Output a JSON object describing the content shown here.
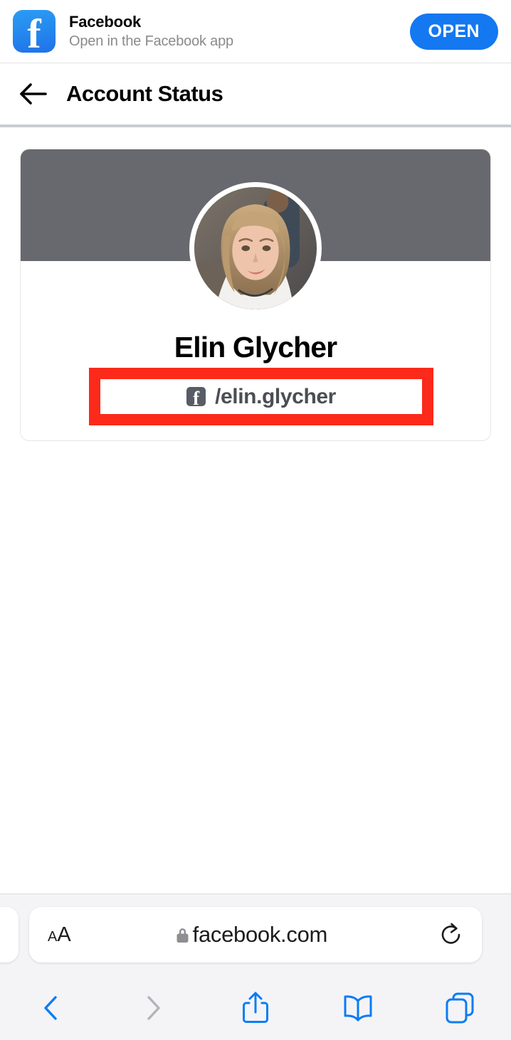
{
  "app_banner": {
    "app_name": "Facebook",
    "subtitle": "Open in the Facebook app",
    "open_label": "OPEN",
    "icon_glyph": "f",
    "icon_name": "facebook-app-icon",
    "accent_color": "#1478f0"
  },
  "nav": {
    "title": "Account Status",
    "back_icon": "back-arrow-icon"
  },
  "profile": {
    "cover_color": "#68696e",
    "display_name": "Elin Glycher",
    "handle": "/elin.glycher",
    "handle_badge_glyph": "f",
    "highlight_color": "#fb2a1b"
  },
  "browser": {
    "aa_small": "A",
    "aa_large": "A",
    "url": "facebook.com",
    "lock_icon": "lock-icon",
    "reload_icon": "reload-icon",
    "toolbar": [
      {
        "name": "back-icon",
        "label": "Back",
        "enabled": true
      },
      {
        "name": "forward-icon",
        "label": "Forward",
        "enabled": false
      },
      {
        "name": "share-icon",
        "label": "Share",
        "enabled": true
      },
      {
        "name": "bookmarks-icon",
        "label": "Bookmarks",
        "enabled": true
      },
      {
        "name": "tabs-icon",
        "label": "Tabs",
        "enabled": true
      }
    ]
  }
}
